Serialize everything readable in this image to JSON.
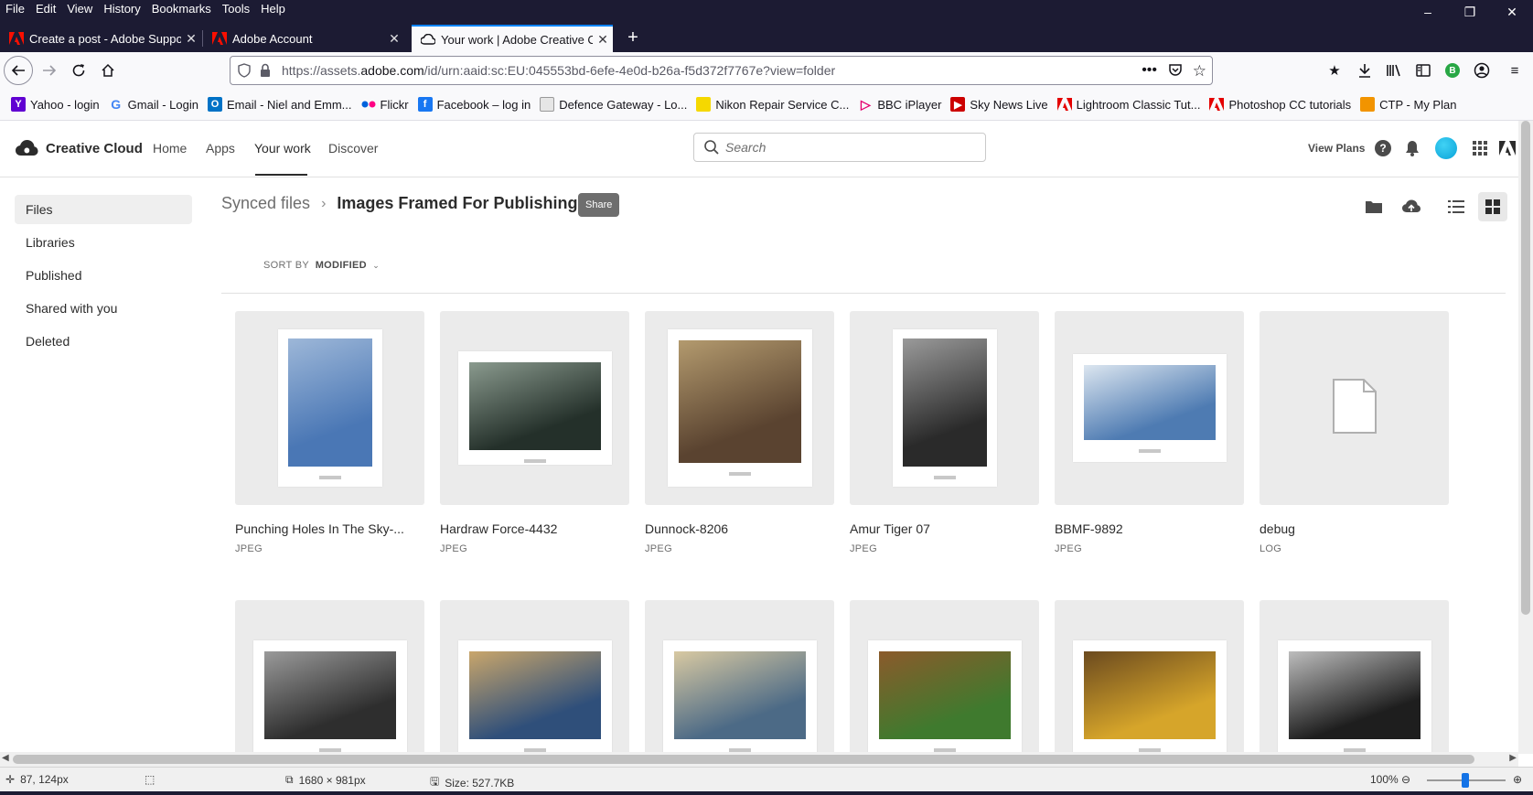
{
  "menubar": [
    "File",
    "Edit",
    "View",
    "History",
    "Bookmarks",
    "Tools",
    "Help"
  ],
  "tabs": [
    {
      "title": "Create a post - Adobe Support",
      "favicon": "adobe-icon"
    },
    {
      "title": "Adobe Account",
      "favicon": "adobe-icon"
    },
    {
      "title": "Your work | Adobe Creative Clo",
      "favicon": "creative-cloud-icon",
      "active": true
    }
  ],
  "urlbar": {
    "prefix": "https://assets.",
    "domain": "adobe.com",
    "suffix": "/id/urn:aaid:sc:EU:045553bd-6efe-4e0d-b26a-f5d372f7767e?view=folder"
  },
  "bookmarks": [
    {
      "label": "Yahoo - login",
      "icon": "yahoo-icon",
      "color": "#6001d2"
    },
    {
      "label": "Gmail - Login",
      "icon": "google-icon",
      "color": "#4285f4"
    },
    {
      "label": "Email - Niel and Emm...",
      "icon": "outlook-icon",
      "color": "#0072c6"
    },
    {
      "label": "Flickr",
      "icon": "flickr-icon",
      "color": "#0063dc"
    },
    {
      "label": "Facebook – log in",
      "icon": "facebook-icon",
      "color": "#1877f2"
    },
    {
      "label": "Defence Gateway - Lo...",
      "icon": "page-icon",
      "color": "#7a7a7a"
    },
    {
      "label": "Nikon Repair Service C...",
      "icon": "nikon-icon",
      "color": "#f5d800"
    },
    {
      "label": "BBC iPlayer",
      "icon": "iplayer-icon",
      "color": "#e4006e"
    },
    {
      "label": "Sky News Live",
      "icon": "youtube-icon",
      "color": "#cc0000"
    },
    {
      "label": "Lightroom Classic Tut...",
      "icon": "adobe-icon",
      "color": "#e40000"
    },
    {
      "label": "Photoshop CC tutorials",
      "icon": "adobe-icon",
      "color": "#e40000"
    },
    {
      "label": "CTP - My Plan",
      "icon": "ctp-icon",
      "color": "#f29400"
    }
  ],
  "cc_header": {
    "brand": "Creative Cloud",
    "nav": [
      "Home",
      "Apps",
      "Your work",
      "Discover"
    ],
    "active_nav": "Your work",
    "search_placeholder": "Search",
    "view_plans": "View Plans"
  },
  "sidebar": {
    "items": [
      "Files",
      "Libraries",
      "Published",
      "Shared with you",
      "Deleted"
    ],
    "active": "Files"
  },
  "breadcrumb": {
    "root": "Synced files",
    "separator": "›",
    "current": "Images Framed For Publishing",
    "share_tooltip": "Share"
  },
  "sort": {
    "label": "SORT BY",
    "value": "MODIFIED"
  },
  "files": [
    {
      "name": "Punching Holes In The Sky-...",
      "type": "JPEG",
      "orientation": "portrait",
      "colors": [
        "#4a77b5",
        "#9db7d8"
      ]
    },
    {
      "name": "Hardraw Force-4432",
      "type": "JPEG",
      "orientation": "landscape",
      "colors": [
        "#24302a",
        "#8a9a8e"
      ]
    },
    {
      "name": "Dunnock-8206",
      "type": "JPEG",
      "orientation": "squarish",
      "colors": [
        "#5a4330",
        "#b39a6e"
      ]
    },
    {
      "name": "Amur Tiger 07",
      "type": "JPEG",
      "orientation": "portrait",
      "colors": [
        "#2a2a2a",
        "#9a9a9a"
      ]
    },
    {
      "name": "BBMF-9892",
      "type": "JPEG",
      "orientation": "wide",
      "colors": [
        "#4e7bb2",
        "#dce6f0"
      ]
    },
    {
      "name": "debug",
      "type": "LOG",
      "orientation": "file",
      "colors": [
        "#ffffff",
        "#b0b0b0"
      ]
    },
    {
      "name": "",
      "type": "",
      "orientation": "landscape",
      "colors": [
        "#2e2e2e",
        "#9a9a9a"
      ]
    },
    {
      "name": "",
      "type": "",
      "orientation": "landscape",
      "colors": [
        "#2f4f7a",
        "#c9a66b"
      ]
    },
    {
      "name": "",
      "type": "",
      "orientation": "landscape",
      "colors": [
        "#4c6a86",
        "#d8c9a2"
      ]
    },
    {
      "name": "",
      "type": "",
      "orientation": "landscape",
      "colors": [
        "#3f7a2e",
        "#8b5a2b"
      ]
    },
    {
      "name": "",
      "type": "",
      "orientation": "landscape",
      "colors": [
        "#d6a52a",
        "#6b4a1f"
      ]
    },
    {
      "name": "",
      "type": "",
      "orientation": "landscape",
      "colors": [
        "#1e1e1e",
        "#bdbdbd"
      ]
    }
  ],
  "status": {
    "cursor": "87, 124px",
    "dimensions": "1680 × 981px",
    "size": "Size: 527.7KB",
    "zoom": "100%"
  },
  "colors": {
    "frame": "#1c1b33",
    "tab_accent": "#0a84ff",
    "cc_blue": "#1473e6"
  }
}
